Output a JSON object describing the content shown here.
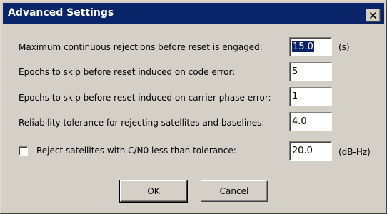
{
  "window": {
    "title": "Advanced Settings",
    "close_symbol": "close-icon"
  },
  "settings": [
    {
      "label": "Maximum continuous rejections before reset is engaged:",
      "value": "15.0",
      "unit": "(s)",
      "selected": true
    },
    {
      "label": "Epochs to skip before reset induced on code error:",
      "value": "5",
      "unit": ""
    },
    {
      "label": "Epochs to skip before reset induced on carrier phase error:",
      "value": "1",
      "unit": ""
    },
    {
      "label": "Reliability tolerance for rejecting satellites and baselines:",
      "value": "4.0",
      "unit": ""
    }
  ],
  "cn0": {
    "checkbox_label": "Reject satellites with C/N0 less than tolerance:",
    "checked": false,
    "value": "20.0",
    "unit": "(dB-Hz)"
  },
  "buttons": {
    "ok": "OK",
    "cancel": "Cancel"
  },
  "colors": {
    "titlebar": "#0a246a",
    "face": "#d4d0c8",
    "selection": "#0a246a"
  }
}
